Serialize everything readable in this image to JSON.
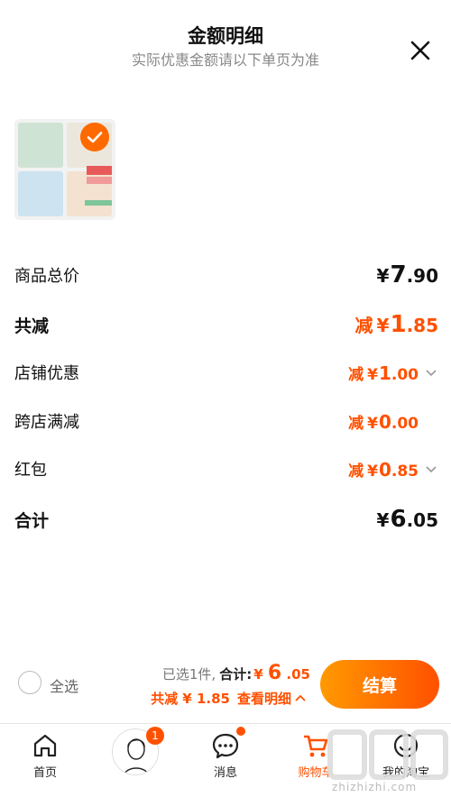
{
  "header": {
    "title": "金额明细",
    "subtitle": "实际优惠金额请以下单页为准"
  },
  "rows": [
    {
      "label": "商品总价",
      "prefix": "",
      "currency": "¥",
      "int": "7",
      "dec": ".90",
      "color": "dark"
    },
    {
      "label": "共减",
      "prefix": "减",
      "currency": "¥",
      "int": "1",
      "dec": ".85",
      "color": "orange"
    },
    {
      "label": "店铺优惠",
      "prefix": "减",
      "currency": "¥",
      "int": "1",
      "dec": ".00",
      "color": "orange"
    },
    {
      "label": "跨店满减",
      "prefix": "减",
      "currency": "¥",
      "int": "0",
      "dec": ".00",
      "color": "orange"
    },
    {
      "label": "红包",
      "prefix": "减",
      "currency": "¥",
      "int": "0",
      "dec": ".85",
      "color": "orange"
    },
    {
      "label": "合计",
      "prefix": "",
      "currency": "¥",
      "int": "6",
      "dec": ".05",
      "color": "dark"
    }
  ],
  "bottom": {
    "select_all": "全选",
    "selected": "已选1件,",
    "total_label": "合计:",
    "total_currency": "¥",
    "total_int": "6",
    "total_dec": ".05",
    "discount": "共减 ¥ 1.85",
    "detail": "查看明细",
    "checkout": "结算"
  },
  "tabbar": {
    "items": [
      {
        "label": "首页",
        "icon": "home-icon"
      },
      {
        "label": "",
        "icon": "avatar"
      },
      {
        "label": "消息",
        "icon": "message-icon"
      },
      {
        "label": "购物车",
        "icon": "cart-icon"
      },
      {
        "label": "我的淘宝",
        "icon": "profile-icon"
      }
    ],
    "badge": "1"
  },
  "watermark": {
    "text": "zhizhizhi.com"
  },
  "colors": {
    "accent": "#ff5000",
    "accent_light": "#ff9a00"
  }
}
